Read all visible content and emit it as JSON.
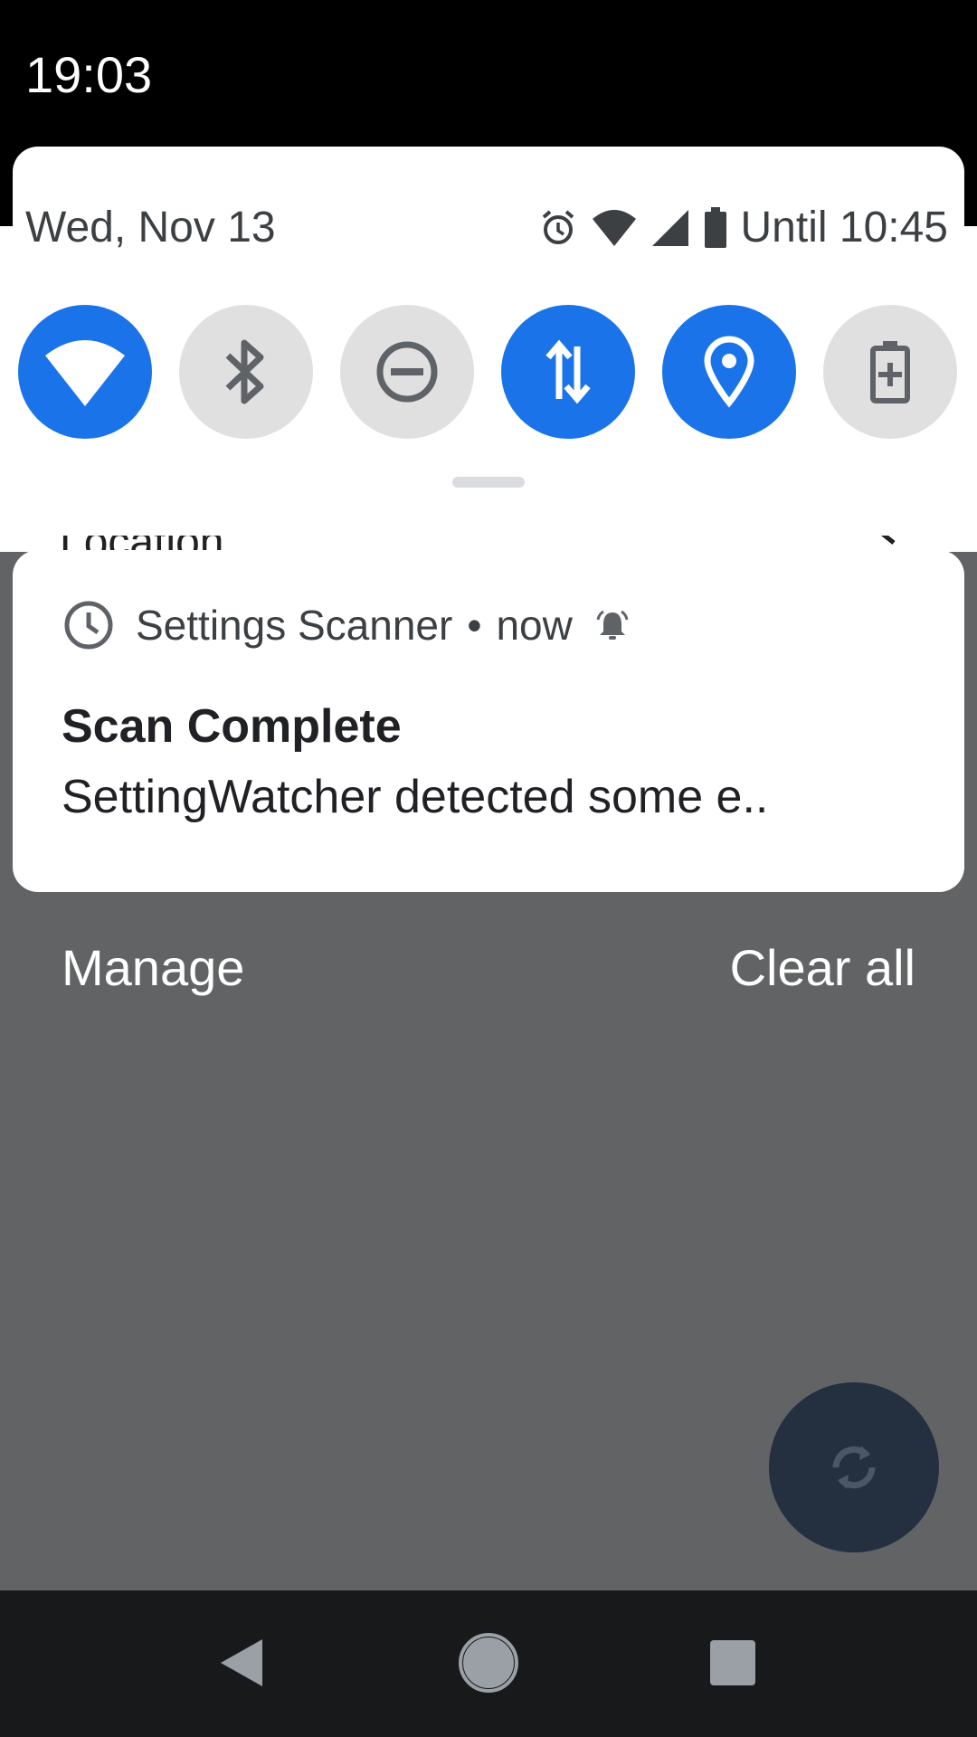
{
  "status_bar": {
    "time": "19:03"
  },
  "background_app": {
    "visible_row": "Location"
  },
  "quick_settings": {
    "date": "Wed, Nov 13",
    "battery_until": "Until 10:45",
    "status_icons": [
      "alarm-icon",
      "wifi-icon",
      "signal-icon",
      "battery-icon"
    ],
    "tiles": [
      {
        "name": "wifi",
        "icon": "wifi-icon",
        "state": "on"
      },
      {
        "name": "bluetooth",
        "icon": "bluetooth-icon",
        "state": "off"
      },
      {
        "name": "do-not-disturb",
        "icon": "do-not-disturb-icon",
        "state": "off"
      },
      {
        "name": "mobile-data",
        "icon": "data-arrows-icon",
        "state": "on"
      },
      {
        "name": "location",
        "icon": "location-pin-icon",
        "state": "on"
      },
      {
        "name": "battery-saver",
        "icon": "battery-saver-icon",
        "state": "off"
      }
    ]
  },
  "notification": {
    "app_name": "Settings Scanner",
    "separator": "•",
    "time": "now",
    "title": "Scan Complete",
    "text": "SettingWatcher detected some e.."
  },
  "actions": {
    "manage": "Manage",
    "clear_all": "Clear all"
  },
  "colors": {
    "accent": "#1a73e8",
    "tile_off": "#e0e0e0",
    "scrim": "#626365",
    "fab": "#243040",
    "nav_bar": "#18191b"
  }
}
